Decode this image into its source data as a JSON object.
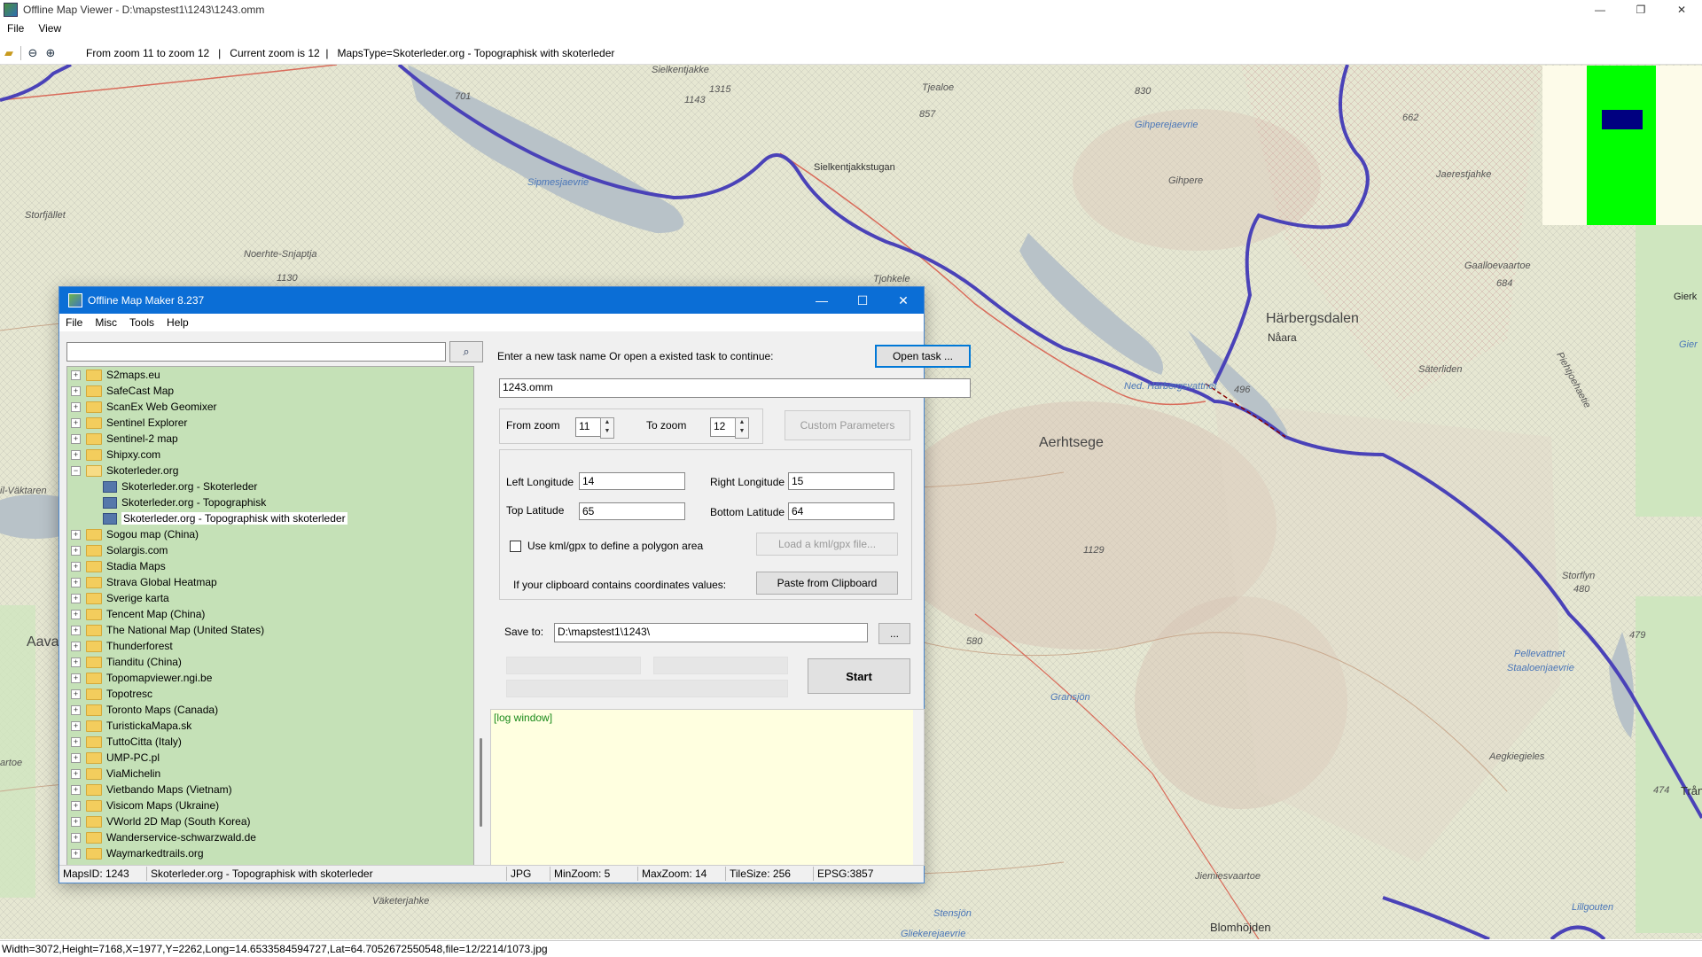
{
  "window": {
    "title": "Offline Map Viewer - D:\\mapstest1\\1243\\1243.omm",
    "menu": [
      "File",
      "View"
    ],
    "min_glyph": "—",
    "max_glyph": "❐",
    "close_glyph": "✕"
  },
  "toolbar": {
    "open_icon": "folder-open-icon",
    "zoom_out_icon": "zoom-out-icon",
    "zoom_in_icon": "zoom-in-icon",
    "info": "From zoom 11 to zoom 12   |   Current zoom is 12  |   MapsType=Skoterleder.org - Topographisk with skoterleder"
  },
  "map": {
    "labels": {
      "sielkentjakke": "Sielkentjakke",
      "n1315": "1315",
      "n1143": "1143",
      "n701": "701",
      "tjealoe": "Tjealoe",
      "n857": "857",
      "n830": "830",
      "gihperejaevrie": "Gihperejaevrie",
      "n662": "662",
      "jaerestjahke": "Jaerestjahke",
      "sielkentjakkstugan": "Sielkentjakkstugan",
      "sipmesjaevrie": "Sipmesjaevrie",
      "gihpere": "Gihpere",
      "storfjallet": "Storfjället",
      "noerhte": "Noerhte-Snjaptja",
      "n1130": "1130",
      "tjohkele": "Tjohkele",
      "haarbergsdalen": "Härbergsdalen",
      "naara": "Nåara",
      "saeterliden": "Säterliden",
      "gaalloevaartoe": "Gaalloevaartoe",
      "n684": "684",
      "nedharbergs": "Ned. Härbergsvattnet",
      "n496": "496",
      "aerhtsege": "Aerhtsege",
      "piehtjoe": "Piehtjoehaetie",
      "giers": "Gierk",
      "gier": "Gier",
      "valkaren": "il-Väktaren",
      "n1129": "1129",
      "storfly": "Storflyn",
      "n480": "480",
      "n479": "479",
      "aava": "Aava",
      "n580": "580",
      "gransjon": "Gransjön",
      "pellevattnet": "Pellevattnet",
      "staaloe": "Staaloenjaevrie",
      "artoe": "artoe",
      "aegkiegieles": "Aegkiegieles",
      "n474": "474",
      "trang": "Trång",
      "jiemies": "Jiemiesvaartoe",
      "vaketer": "Väketerjahke",
      "stensjon": "Stensjön",
      "gliekere": "Gliekerejaevrie",
      "blomhojden": "Blomhöjden",
      "lillgouten": "Lillgouten"
    }
  },
  "dialog": {
    "title": "Offline Map Maker 8.237",
    "menu": [
      "File",
      "Misc",
      "Tools",
      "Help"
    ],
    "search_value": "",
    "search_icon": "magnifier-icon",
    "tree": [
      {
        "type": "folder",
        "label": "S2maps.eu"
      },
      {
        "type": "folder",
        "label": "SafeCast Map"
      },
      {
        "type": "folder",
        "label": "ScanEx Web Geomixer"
      },
      {
        "type": "folder",
        "label": "Sentinel Explorer"
      },
      {
        "type": "folder",
        "label": "Sentinel-2 map"
      },
      {
        "type": "folder",
        "label": "Shipxy.com"
      },
      {
        "type": "open",
        "label": "Skoterleder.org"
      },
      {
        "type": "leaf",
        "label": "Skoterleder.org - Skoterleder"
      },
      {
        "type": "leaf",
        "label": "Skoterleder.org - Topographisk"
      },
      {
        "type": "leafsel",
        "label": "Skoterleder.org - Topographisk with skoterleder"
      },
      {
        "type": "folder",
        "label": "Sogou map (China)"
      },
      {
        "type": "folder",
        "label": "Solargis.com"
      },
      {
        "type": "folder",
        "label": "Stadia Maps"
      },
      {
        "type": "folder",
        "label": "Strava Global Heatmap"
      },
      {
        "type": "folder",
        "label": "Sverige karta"
      },
      {
        "type": "folder",
        "label": "Tencent Map (China)"
      },
      {
        "type": "folder",
        "label": "The National Map (United States)"
      },
      {
        "type": "folder",
        "label": "Thunderforest"
      },
      {
        "type": "folder",
        "label": "Tianditu (China)"
      },
      {
        "type": "folder",
        "label": "Topomapviewer.ngi.be"
      },
      {
        "type": "folder",
        "label": "Topotresc"
      },
      {
        "type": "folder",
        "label": "Toronto Maps (Canada)"
      },
      {
        "type": "folder",
        "label": "TuristickaMapa.sk"
      },
      {
        "type": "folder",
        "label": "TuttoCitta (Italy)"
      },
      {
        "type": "folder",
        "label": "UMP-PC.pl"
      },
      {
        "type": "folder",
        "label": "ViaMichelin"
      },
      {
        "type": "folder",
        "label": "Vietbando Maps (Vietnam)"
      },
      {
        "type": "folder",
        "label": "Visicom Maps (Ukraine)"
      },
      {
        "type": "folder",
        "label": "VWorld 2D Map (South Korea)"
      },
      {
        "type": "folder",
        "label": "Wanderservice-schwarzwald.de"
      },
      {
        "type": "folder",
        "label": "Waymarkedtrails.org"
      }
    ],
    "task_prompt": "Enter a new task name Or open a existed task to continue:",
    "open_task": "Open task ...",
    "task_name": "1243.omm",
    "from_zoom_label": "From zoom",
    "from_zoom": "11",
    "to_zoom_label": "To zoom",
    "to_zoom": "12",
    "custom_params": "Custom Parameters",
    "left_lon_label": "Left Longitude",
    "left_lon": "14",
    "right_lon_label": "Right Longitude",
    "right_lon": "15",
    "top_lat_label": "Top Latitude",
    "top_lat": "65",
    "bottom_lat_label": "Bottom Latitude",
    "bottom_lat": "64",
    "kml_label": "Use kml/gpx to define a polygon area",
    "load_kml": "Load a kml/gpx file...",
    "clipboard_label": "If your clipboard contains coordinates values:",
    "paste": "Paste from Clipboard",
    "save_label": "Save to:",
    "save_path": "D:\\mapstest1\\1243\\",
    "browse": "...",
    "start": "Start",
    "log": "[log window]",
    "status": {
      "mapsid": "MapsID: 1243",
      "name": "Skoterleder.org - Topographisk with skoterleder",
      "fmt": "JPG",
      "minzoom": "MinZoom: 5",
      "maxzoom": "MaxZoom: 14",
      "tilesize": "TileSize: 256",
      "epsg": "EPSG:3857"
    }
  },
  "statusbar": "Width=3072,Height=7168,X=1977,Y=2262,Long=14.6533584594727,Lat=64.7052672550548,file=12/2214/1073.jpg"
}
